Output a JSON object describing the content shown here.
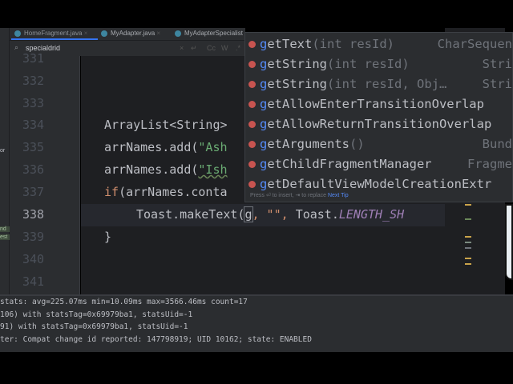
{
  "tabs": [
    {
      "label": "HomeFragment.java",
      "active": true
    },
    {
      "label": "MyAdapter.java",
      "active": false
    },
    {
      "label": "MyAdapterSpecialist",
      "active": false
    }
  ],
  "search": {
    "value": "specialdrid",
    "icons": [
      "search-icon",
      "close-icon",
      "replace-icon",
      "match-case-icon",
      "whole-word-icon",
      "regex-icon"
    ],
    "match_case": "Cc",
    "whole_word": "W",
    "regex": ".*"
  },
  "gutter": {
    "lines": [
      "331",
      "332",
      "333",
      "334",
      "335",
      "336",
      "337",
      "338",
      "339",
      "340",
      "341"
    ],
    "current": "338"
  },
  "code": {
    "l334": "ArrayList<String>",
    "l335_a": "arrNames.add(",
    "l335_s": "\"Ash",
    "l336_a": "arrNames.add(",
    "l336_s": "\"Ish",
    "l337_kw": "if",
    "l337_a": "(arrNames.conta",
    "l338_a": "Toast.makeText(",
    "l338_caret": "g",
    "l338_b": ", \"\", ",
    "l338_c": "Toast.",
    "l338_const": "LENGTH_SH",
    "l339": "}"
  },
  "completion": {
    "items": [
      {
        "name": "getText",
        "params": "(int resId)",
        "type": "CharSequen"
      },
      {
        "name": "getString",
        "params": "(int resId)",
        "type": "Stri"
      },
      {
        "name": "getString",
        "params": "(int resId, Obj…",
        "type": "Stri"
      },
      {
        "name": "getAllowEnterTransitionOverlap",
        "params": "",
        "type": ""
      },
      {
        "name": "getAllowReturnTransitionOverlap",
        "params": "",
        "type": ""
      },
      {
        "name": "getArguments",
        "params": "()",
        "type": "Bund"
      },
      {
        "name": "getChildFragmentManager",
        "params": "",
        "type": "Fragme"
      },
      {
        "name": "getDefaultViewModelCreationExtr",
        "params": "",
        "type": ""
      }
    ],
    "hint": "Press ⏎ to insert, ⇥ to replace",
    "next_tip": "Next Tip"
  },
  "left_fragments": [
    "or",
    "nd",
    "est"
  ],
  "log": [
    "stats: avg=225.07ms min=10.09ms max=3566.46ms count=17",
    "106) with statsTag=0x69979ba1, statsUid=-1",
    "91) with statsTag=0x69979ba1, statsUid=-1",
    "ter: Compat change id reported: 147798919; UID 10162; state: ENABLED"
  ],
  "colors": {
    "method_icon": "#c75450",
    "accent": "#548af7",
    "string": "#6aab73",
    "keyword": "#cf8e6d"
  }
}
